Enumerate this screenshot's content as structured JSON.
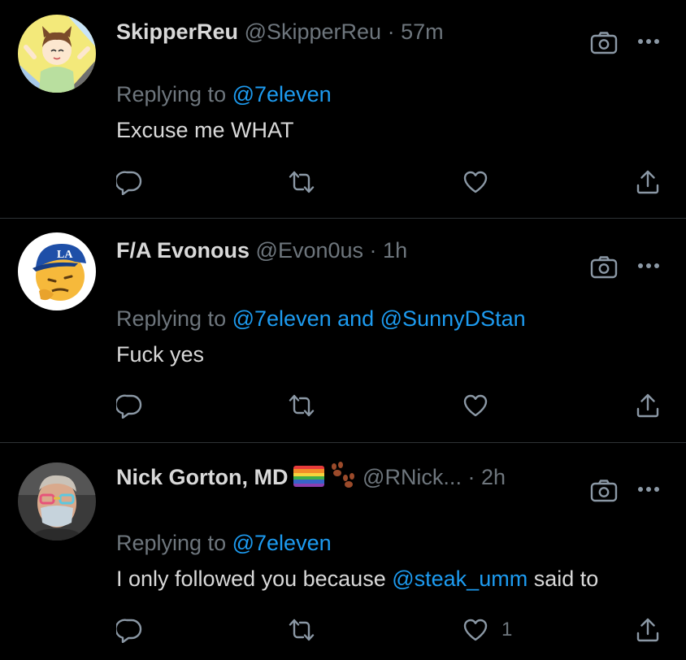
{
  "tweets": [
    {
      "display_name": "SkipperReu",
      "handle": "@SkipperReu",
      "separator": "·",
      "time": "57m",
      "replying_prefix": "Replying to",
      "replying_handles": "@7eleven",
      "body": "Excuse me WHAT",
      "like_count": ""
    },
    {
      "display_name": "F/A Evonous",
      "handle": "@Evon0us",
      "separator": "·",
      "time": "1h",
      "replying_prefix": "Replying to",
      "replying_handles": "@7eleven and @SunnyDStan",
      "body": "Fuck yes",
      "like_count": ""
    },
    {
      "display_name": "Nick Gorton, MD",
      "handle": "@RNick...",
      "separator": "·",
      "time": "2h",
      "replying_prefix": "Replying to",
      "replying_handles": "@7eleven",
      "body_before": "I only followed you because",
      "body_mention": "@steak_umm",
      "body_after": "said to",
      "like_count": "1"
    }
  ],
  "icons": {
    "camera": "camera-icon",
    "more": "more-dots-icon",
    "reply": "reply-bubble-icon",
    "retweet": "retweet-icon",
    "like": "heart-icon",
    "share": "share-upload-icon",
    "flag": "rainbow-flag-emoji",
    "paw": "paw-prints-emoji"
  },
  "colors": {
    "background": "#000000",
    "text": "#d9d9d9",
    "muted": "#6e767d",
    "link": "#1d9bf0",
    "divider": "#2f3336"
  }
}
